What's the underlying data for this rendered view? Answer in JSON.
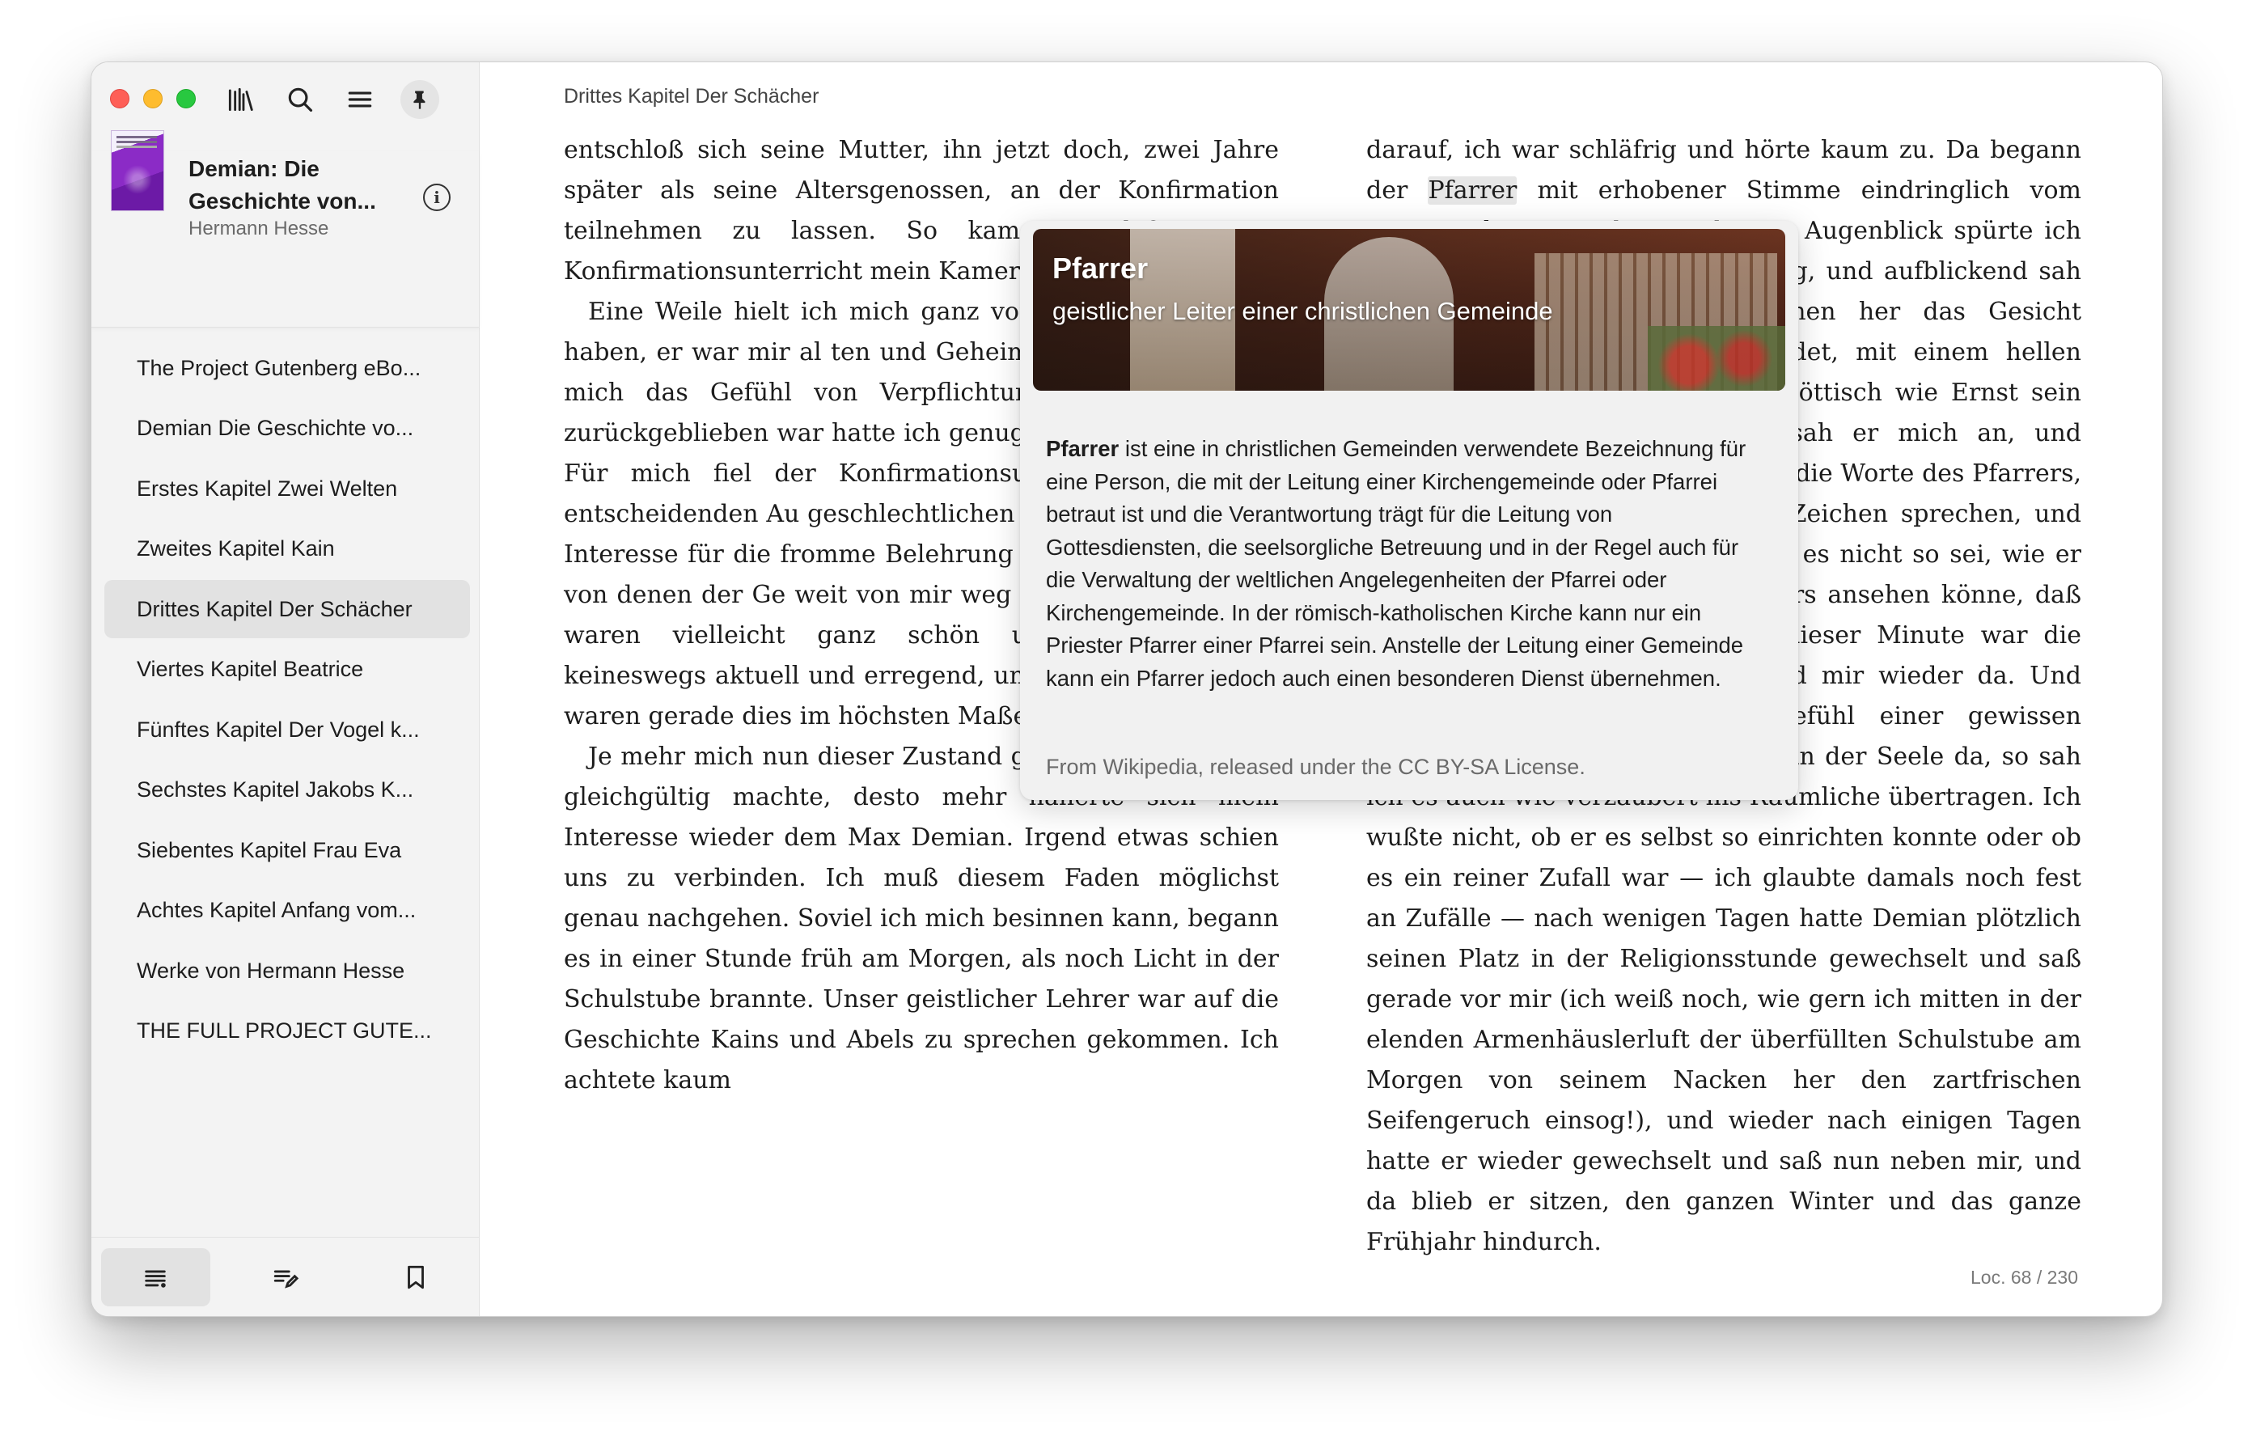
{
  "sidebar": {
    "book": {
      "title": "Demian: Die Geschichte von...",
      "author": "Hermann Hesse"
    },
    "toc": [
      "The Project Gutenberg eBo...",
      "Demian Die Geschichte vo...",
      "Erstes Kapitel Zwei Welten",
      "Zweites Kapitel Kain",
      "Drittes Kapitel Der Schächer",
      "Viertes Kapitel Beatrice",
      "Fünftes Kapitel Der Vogel k...",
      "Sechstes Kapitel Jakobs K...",
      "Siebentes Kapitel Frau Eva",
      "Achtes Kapitel Anfang vom...",
      "Werke von Hermann Hesse",
      "THE FULL PROJECT GUTE..."
    ],
    "active_index": 4,
    "icons": [
      "library-icon",
      "search-icon",
      "menu-icon",
      "pin-icon",
      "info-icon",
      "toc-list-icon",
      "annotations-icon",
      "bookmark-icon"
    ]
  },
  "reader": {
    "chapter_title": "Drittes Kapitel Der Schächer",
    "left_column": [
      "entschloß sich seine Mutter, ihn jetzt doch, zwei Jahre spä­ter als seine Altersgenossen, an der Konfirmation teilneh­men zu lassen. So kam es, daß er im Konfirmationsunterricht mein Kamer",
      "Eine Weile hielt ich mich ganz von i nicht teil an ihm haben, er war mir al ten und Geheimnissen umgeben, na mich das Gefühl von Verpflichtung, Kromer in mir zurückgeblieben war hatte ich genug mit meinen eigenen Für mich fiel der Konfirmationsunter der Zeit der entscheidenden Au geschlechtlichen Dingen, und trotz gu Interesse für die fromme Belehrung trächtigt. Die Dinge, von denen der Ge weit von mir weg in einer stillen heilig waren vielleicht ganz schön und wertvol, aber keineswegs aktuell und erregend, und jene andern Dinge waren gerade dies im höchsten Maße.",
      "Je mehr mich nun dieser Zustand gegen den Unterricht gleichgültig machte, desto mehr näherte sich mein Interes­se wieder dem Max Demian. Irgend etwas schien uns zu verbinden. Ich muß diesem Faden möglichst genau nach­gehen. Soviel ich mich besinnen kann, begann es in einer Stunde früh am Morgen, als noch Licht in der Schulstube brannte. Unser geistlicher Lehrer war auf die Geschichte Kains und Abels zu sprechen gekommen. Ich achtete kaum"
    ],
    "right_column": {
      "before_highlight": "darauf, ich war schläfrig und hörte kaum zu. Da begann der ",
      "highlight": "Pfarrer",
      "after_highlight": " mit erhobener Stimme eindringlich vom Kainszei­chen zu reden. In diesem Augenblick spürte ich eine Art Berührung oder Mahnung, und aufblickend sah ich aus den vorderen Bankreihen her das Gesicht Demians nach mir zurückgewendet, mit einem hellen sprechenden Auge, das so gut spöttisch wie Ernst sein konnte. Nur einen Augenblick sah er mich an, und plötzlich horchte ich gespannt auf die Worte des Pfarrers, hörte ihn vom Kain und seinem Zeichen sprechen, und spürte tief in mir ein Wis­sen, daß es nicht so sei, wie er es lehre, daß man das auch anders ansehen könne, daß daran Kritik möglich war! Mit dieser Minute war die Verbindung zwischen Demian und mir wieder da. Und seltsam — kaum war dies Gefühl einer gewissen seelischen Zusammengehörigkeit in der Seele da, so sah ich es auch wie verzaubert ins Räumliche übertra­gen. Ich wußte nicht, ob er es selbst so einrichten konnte oder ob es ein reiner Zufall war — ich glaubte damals noch fest an Zufälle — nach wenigen Tagen hatte Demian plötz­lich seinen Platz in der Religionsstunde gewechselt und saß gerade vor mir (ich weiß noch, wie gern ich mitten in der elenden Armenhäuslerluft der überfüllten Schulstube am Morgen von seinem Nacken her den zartfrischen Seifenge­ruch einsog!), und wieder nach einigen Tagen hatte er wie­der gewechselt und saß nun neben mir, und da blieb er sitzen, den ganzen Winter und das ganze Frühjahr hin­durch."
    },
    "location": "Loc. 68 / 230"
  },
  "popover": {
    "title": "Pfarrer",
    "subtitle": "geistlicher Leiter einer christlichen Gemeinde",
    "term": "Pfarrer",
    "body": " ist eine in christlichen Gemeinden verwendete Bezeichnung für eine Person, die mit der Leitung einer Kirchengemeinde oder Pfarrei betraut ist und die Verantwortung trägt für die Leitung von Gottesdiensten, die seelsorgliche Betreuung und in der Regel auch für die Verwaltung der weltlichen Angelegenheiten der Pfarrei oder Kirchengemeinde. In der römisch-katholischen Kirche kann nur ein Priester Pfarrer einer Pfarrei sein. Anstelle der Leitung einer Gemeinde kann ein Pfarrer jedoch auch einen besonderen Dienst übernehmen.",
    "attribution": "From Wikipedia, released under the CC BY-SA License."
  }
}
